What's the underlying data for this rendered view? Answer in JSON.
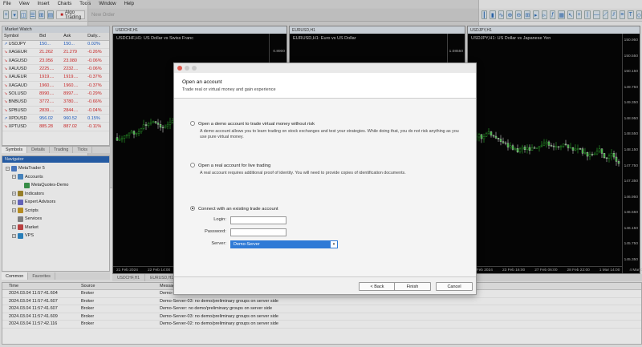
{
  "menu": [
    "File",
    "View",
    "Insert",
    "Charts",
    "Tools",
    "Window",
    "Help"
  ],
  "toolbar": {
    "algo_trading": "Algo Trading",
    "new_order": "New Order"
  },
  "market_watch": {
    "title": "Market Watch",
    "columns": [
      "Symbol",
      "Bid",
      "Ask",
      "Daily..."
    ],
    "rows": [
      {
        "symbol": "USDJPY",
        "bid": "150...",
        "ask": "150...",
        "chg": "0.02%",
        "dir": "up"
      },
      {
        "symbol": "XAGEUR",
        "bid": "21.262",
        "ask": "21.279",
        "chg": "-0.26%",
        "dir": "dn"
      },
      {
        "symbol": "XAGUSD",
        "bid": "23.056",
        "ask": "23.080",
        "chg": "-0.06%",
        "dir": "dn"
      },
      {
        "symbol": "XAUUSD",
        "bid": "2225....",
        "ask": "2232....",
        "chg": "-0.06%",
        "dir": "dn"
      },
      {
        "symbol": "XAUEUR",
        "bid": "1919....",
        "ask": "1919....",
        "chg": "-0.37%",
        "dir": "dn"
      },
      {
        "symbol": "XAGAUD",
        "bid": "1960....",
        "ask": "1960....",
        "chg": "-0.37%",
        "dir": "dn"
      },
      {
        "symbol": "SOLUSD",
        "bid": "8990....",
        "ask": "8997....",
        "chg": "-0.29%",
        "dir": "dn"
      },
      {
        "symbol": "BNBUSD",
        "bid": "3772....",
        "ask": "3780....",
        "chg": "-0.66%",
        "dir": "dn"
      },
      {
        "symbol": "SPBUSD",
        "bid": "2839....",
        "ask": "2844....",
        "chg": "-0.04%",
        "dir": "dn"
      },
      {
        "symbol": "XPDUSD",
        "bid": "956.02",
        "ask": "960.52",
        "chg": "0.15%",
        "dir": "up"
      },
      {
        "symbol": "XPTUSD",
        "bid": "885.28",
        "ask": "887.02",
        "chg": "-0.11%",
        "dir": "dn"
      }
    ],
    "tabs": [
      "Symbols",
      "Details",
      "Trading",
      "Ticks"
    ]
  },
  "navigator": {
    "title": "Navigator",
    "items": [
      {
        "label": "MetaTrader 5",
        "level": 0,
        "exp": "−"
      },
      {
        "label": "Accounts",
        "level": 1,
        "exp": "−"
      },
      {
        "label": "MetaQuotes-Demo",
        "level": 2,
        "exp": ""
      },
      {
        "label": "Indicators",
        "level": 1,
        "exp": "+"
      },
      {
        "label": "Expert Advisors",
        "level": 1,
        "exp": "+"
      },
      {
        "label": "Scripts",
        "level": 1,
        "exp": "+"
      },
      {
        "label": "Services",
        "level": 1,
        "exp": ""
      },
      {
        "label": "Market",
        "level": 1,
        "exp": "+"
      },
      {
        "label": "VPS",
        "level": 1,
        "exp": "+"
      }
    ],
    "tabs": [
      "Common",
      "Favorites"
    ]
  },
  "charts": [
    {
      "header": "USDCHF,H1",
      "caption": "USDCHF,H1: US Dollar vs Swiss Franc",
      "ticks": [
        "0.8900"
      ],
      "x": [
        "21 Feb 2024",
        "22 Feb 14:00"
      ]
    },
    {
      "header": "EURUSD,H1",
      "caption": "EURUSD,H1: Euro vs US Dollar",
      "ticks": [
        "1.08550"
      ],
      "x": []
    },
    {
      "header": "USDJPY,H1",
      "caption": "USDJPY,H1: US Dollar vs Japanese Yen",
      "ticks": [
        "150.950",
        "150.550",
        "150.150",
        "149.750",
        "149.350",
        "148.950",
        "148.550",
        "148.150",
        "147.750",
        "147.350",
        "146.950",
        "146.550",
        "146.150",
        "145.750",
        "145.350"
      ],
      "x": [
        "21 Feb 2024",
        "23 Feb 16:00",
        "27 Feb 06:00",
        "28 Feb 22:00",
        "1 Mar 14:00",
        "4 Mar 06:00"
      ]
    }
  ],
  "chart_tabs": [
    "USDCHF,H1",
    "EURUSD,H1",
    "USDJPY,H1"
  ],
  "log": {
    "columns": [
      "Time",
      "Source",
      "Message"
    ],
    "rows": [
      {
        "time": "2024.03.04 11:57:41.604",
        "src": "Broker",
        "msg": "Demo-Server: no demo/preliminary groups on server side"
      },
      {
        "time": "2024.03.04 11:57:41.607",
        "src": "Broker",
        "msg": "Demo-Server-03: no demo/preliminary groups on server side"
      },
      {
        "time": "2024.03.04 11:57:41.607",
        "src": "Broker",
        "msg": "Demo-Server: no demo/preliminary groups on server side"
      },
      {
        "time": "2024.03.04 11:57:41.609",
        "src": "Broker",
        "msg": "Demo-Server-03: no demo/preliminary groups on server side"
      },
      {
        "time": "2024.03.04 11:57:42.116",
        "src": "Broker",
        "msg": "Demo-Server-02: no demo/preliminary groups on server side"
      }
    ]
  },
  "dialog": {
    "title": "Open an account",
    "subtitle": "Trade real or virtual money and gain experience",
    "options": [
      {
        "label": "Open a demo account to trade virtual money without risk",
        "desc": "A demo account allows you to learn trading on stock exchanges and test your strategies. While doing that, you do not risk anything as you use pure virtual money.",
        "selected": false
      },
      {
        "label": "Open a real account for live trading",
        "desc": "A real account requires additional proof of identity. You will need to provide copies of identification documents.",
        "selected": false
      },
      {
        "label": "Connect with an existing trade account",
        "desc": "",
        "selected": true
      }
    ],
    "login_label": "Login:",
    "password_label": "Password:",
    "server_label": "Server:",
    "server_value": "Demo-Server",
    "back_label": "< Back",
    "finish_label": "Finish",
    "cancel_label": "Cancel"
  }
}
